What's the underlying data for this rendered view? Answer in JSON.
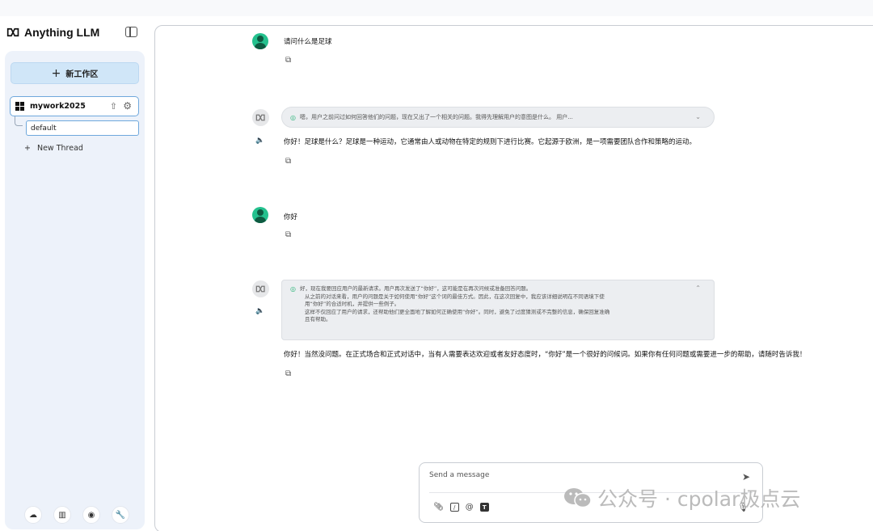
{
  "app": {
    "title": "Anything LLM"
  },
  "sidebar": {
    "new_workspace_label": "新工作区",
    "workspace": {
      "name": "mywork2025"
    },
    "thread": {
      "name": "default"
    },
    "new_thread_label": "New Thread",
    "bottom_icons": [
      "community-hub-icon",
      "docs-book-icon",
      "discord-icon",
      "wrench-settings-icon"
    ]
  },
  "chat": {
    "messages": [
      {
        "role": "user",
        "text": "请问什么是足球"
      },
      {
        "role": "assistant",
        "thought_collapsed": "嗯，用户之前问过如何回答他们的问题，现在又出了一个相关的问题。我得先理解用户的意图是什么。 用户...",
        "text": "你好！足球是什么？足球是一种运动，它通常由人或动物在特定的规则下进行比赛。它起源于欧洲，是一项需要团队合作和策略的运动。"
      },
      {
        "role": "user",
        "text": "你好"
      },
      {
        "role": "assistant",
        "thought_lines": [
          "好，现在我要回应用户的最新请求。用户再次发送了“你好”，这可能是在再次问候或准备回答问题。",
          "从之前的对话来看，用户的问题是关于如何使用“你好”这个词的最佳方式。因此，在这次回复中，我应该详细说明在不同语境下使",
          "用“你好”的合适时机，并提供一些例子。",
          "这样不仅回应了用户的请求，还帮助他们更全面地了解如何正确使用“你好”。同时，避免了过度猜测或不完整的信息，确保回复准确",
          "且有帮助。"
        ],
        "text": "你好！当然没问题。在正式场合和正式对话中，当有人需要表达欢迎或者友好态度时，“你好”是一个很好的问候词。如果你有任何问题或需要进一步的帮助，请随时告诉我！"
      }
    ]
  },
  "composer": {
    "placeholder": "Send a message",
    "tools": [
      "attach-icon",
      "slash-command-icon",
      "at-mention-icon",
      "text-size-icon"
    ]
  },
  "watermark": {
    "text": "公众号 · cpolar极点云"
  },
  "colors": {
    "accent": "#d0e6f8",
    "user_avatar": "#24c18e",
    "thought_bulb": "#2db57a"
  }
}
